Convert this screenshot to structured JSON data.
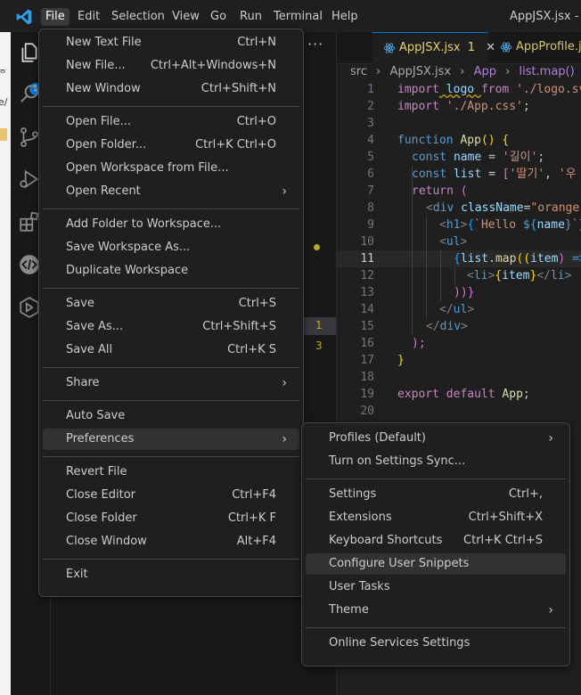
{
  "window": {
    "title": "AppJSX.jsx - my",
    "menubar": [
      "File",
      "Edit",
      "Selection",
      "View",
      "Go",
      "Run",
      "Terminal",
      "Help"
    ],
    "active_menu": "File"
  },
  "activitybar": {
    "icons": [
      "explorer-icon",
      "search-icon",
      "source-control-icon",
      "run-debug-icon",
      "extensions-icon",
      "remote-icon",
      "remote-explorer-icon"
    ],
    "explorer_badge": "1"
  },
  "left_strip_fragments": [
    "ᇂ",
    "e/",
    "a",
    "f"
  ],
  "sidebar": {
    "more_label": "···",
    "counts": [
      "1",
      "3"
    ]
  },
  "tabs": [
    {
      "label": "AppJSX.jsx",
      "badge": "1",
      "close": "✕"
    },
    {
      "label": "AppProfile.jsx"
    }
  ],
  "breadcrumb": [
    "src",
    "›",
    "AppJSX.jsx",
    "›",
    "App",
    "›",
    "list.map()"
  ],
  "code_line_numbers": [
    "1",
    "2",
    "3",
    "4",
    "5",
    "6",
    "7",
    "8",
    "9",
    "10",
    "11",
    "12",
    "13",
    "14",
    "15",
    "16",
    "17",
    "18",
    "19",
    "20"
  ],
  "code": {
    "l1": [
      "import",
      " logo ",
      "from",
      " './logo.sv"
    ],
    "l2": [
      "import",
      " './App.css'",
      ";"
    ],
    "l4": [
      "function",
      " App",
      "()",
      " {"
    ],
    "l5": [
      "const",
      " name",
      " = ",
      "'길이'",
      ";"
    ],
    "l6": [
      "const",
      " list",
      " = ",
      "[",
      "'딸기'",
      ", ",
      "'우"
    ],
    "l7": [
      "return",
      " ("
    ],
    "l8": [
      "<",
      "div",
      " className",
      "=",
      "\"orange\""
    ],
    "l9": [
      "<",
      "h1",
      ">",
      "{",
      "`Hello ",
      "${",
      "name",
      "}",
      "`}"
    ],
    "l10": [
      "<",
      "ul",
      ">"
    ],
    "l11": [
      "{",
      "list",
      ".",
      "map",
      "((",
      "item",
      ")",
      " =>"
    ],
    "l12": [
      "<",
      "li",
      ">",
      "{",
      "item",
      "}",
      "</",
      "li",
      ">"
    ],
    "l13": [
      "))}"
    ],
    "l14": [
      "</",
      "ul",
      ">"
    ],
    "l15": [
      "</",
      "div",
      ">"
    ],
    "l16": [
      ");"
    ],
    "l17": [
      "}"
    ],
    "l19": [
      "export",
      " default",
      " App",
      ";"
    ]
  },
  "file_menu": {
    "groups": [
      [
        {
          "label": "New Text File",
          "key": "Ctrl+N"
        },
        {
          "label": "New File...",
          "key": "Ctrl+Alt+Windows+N"
        },
        {
          "label": "New Window",
          "key": "Ctrl+Shift+N"
        }
      ],
      [
        {
          "label": "Open File...",
          "key": "Ctrl+O"
        },
        {
          "label": "Open Folder...",
          "key": "Ctrl+K Ctrl+O"
        },
        {
          "label": "Open Workspace from File...",
          "key": ""
        },
        {
          "label": "Open Recent",
          "key": "",
          "submenu": true
        }
      ],
      [
        {
          "label": "Add Folder to Workspace...",
          "key": ""
        },
        {
          "label": "Save Workspace As...",
          "key": ""
        },
        {
          "label": "Duplicate Workspace",
          "key": ""
        }
      ],
      [
        {
          "label": "Save",
          "key": "Ctrl+S"
        },
        {
          "label": "Save As...",
          "key": "Ctrl+Shift+S"
        },
        {
          "label": "Save All",
          "key": "Ctrl+K S"
        }
      ],
      [
        {
          "label": "Share",
          "key": "",
          "submenu": true
        }
      ],
      [
        {
          "label": "Auto Save",
          "key": ""
        },
        {
          "label": "Preferences",
          "key": "",
          "submenu": true,
          "highlighted": true
        }
      ],
      [
        {
          "label": "Revert File",
          "key": ""
        },
        {
          "label": "Close Editor",
          "key": "Ctrl+F4"
        },
        {
          "label": "Close Folder",
          "key": "Ctrl+K F"
        },
        {
          "label": "Close Window",
          "key": "Alt+F4"
        }
      ],
      [
        {
          "label": "Exit",
          "key": ""
        }
      ]
    ]
  },
  "preferences_menu": {
    "groups": [
      [
        {
          "label": "Profiles (Default)",
          "key": "",
          "submenu": true
        },
        {
          "label": "Turn on Settings Sync...",
          "key": ""
        }
      ],
      [
        {
          "label": "Settings",
          "key": "Ctrl+,"
        },
        {
          "label": "Extensions",
          "key": "Ctrl+Shift+X"
        },
        {
          "label": "Keyboard Shortcuts",
          "key": "Ctrl+K Ctrl+S"
        },
        {
          "label": "Configure User Snippets",
          "key": "",
          "highlighted": true
        },
        {
          "label": "User Tasks",
          "key": ""
        },
        {
          "label": "Theme",
          "key": "",
          "submenu": true
        }
      ],
      [
        {
          "label": "Online Services Settings",
          "key": ""
        }
      ]
    ]
  },
  "submenu_glyph": "›",
  "colors": {
    "accent": "#0078d4",
    "menu_bg": "#1f1f1f",
    "menu_highlight": "#323232"
  }
}
